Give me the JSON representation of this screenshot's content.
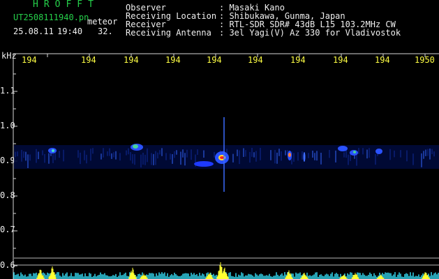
{
  "header": {
    "program": "HROFFT",
    "filename": "UT2508111940.pn",
    "filename_suffix": "meteor",
    "date": "25.08.11",
    "time": "19:40",
    "count": "32.",
    "info": [
      {
        "label": "Observer",
        "value": ": Masaki Kano"
      },
      {
        "label": "Receiving Location",
        "value": ": Shibukawa, Gunma, Japan"
      },
      {
        "label": "Receiver",
        "value": ": RTL-SDR SDR# 43dB L15 103.2MHz CW"
      },
      {
        "label": "Receiving Antenna",
        "value": ": 3el Yagi(V) Az 330 for Vladivostok"
      }
    ]
  },
  "axis": {
    "unit": "kHz",
    "x_ticks": [
      "194",
      "194",
      "194",
      "194",
      "194",
      "194",
      "194",
      "194",
      "194",
      "1950"
    ],
    "y_ticks": [
      "1.1",
      "1.0",
      "0.9",
      "0.8",
      "0.7",
      "0.6"
    ]
  },
  "colors": {
    "program": "#25d04a",
    "text": "#f0f0f0",
    "x_ticks": "#ffff44",
    "background": "#000000"
  }
}
